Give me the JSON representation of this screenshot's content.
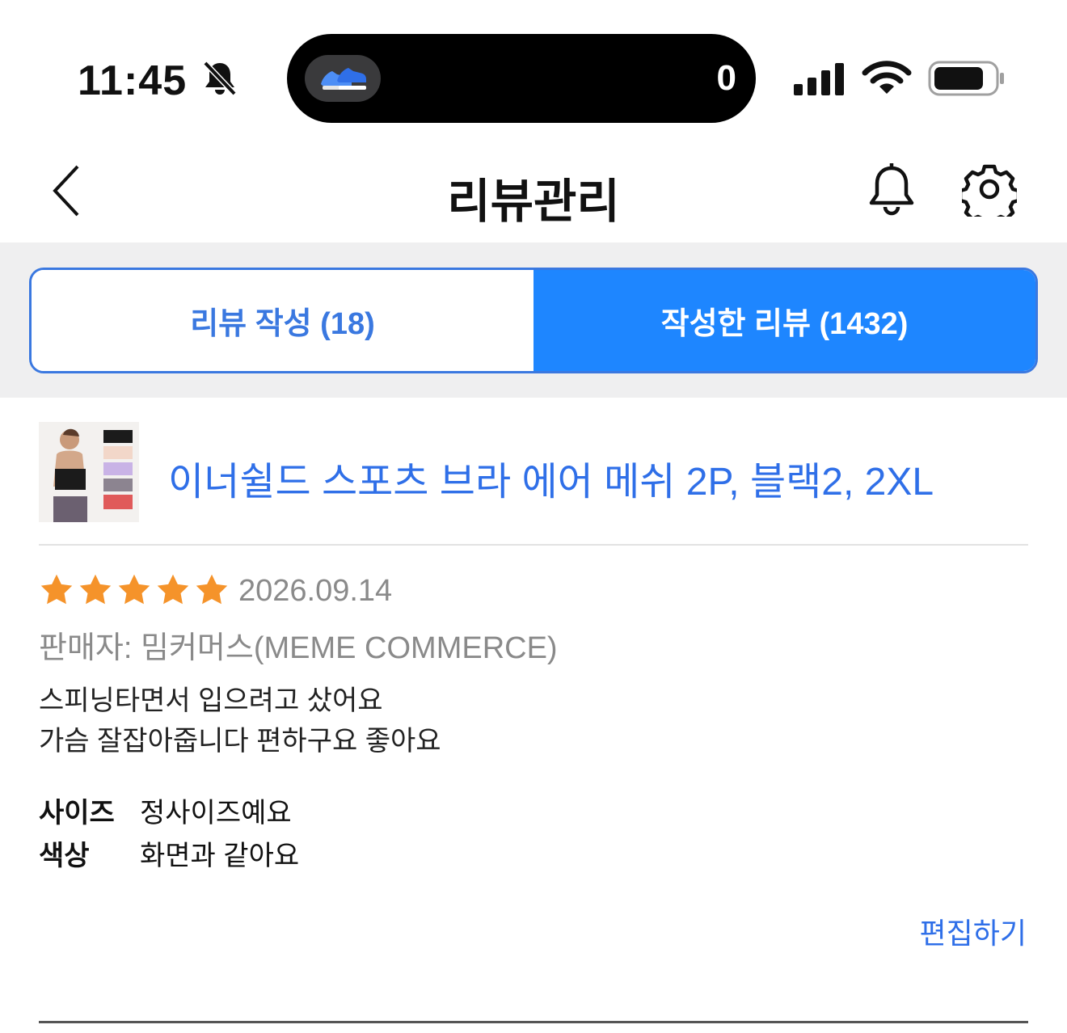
{
  "status_bar": {
    "time": "11:45",
    "island_count": "0",
    "icons": [
      "bell-slash-icon",
      "sneaker-app-icon",
      "signal-icon",
      "wifi-icon",
      "battery-icon"
    ]
  },
  "nav": {
    "title": "리뷰관리",
    "icons": [
      "back-chevron-icon",
      "bell-icon",
      "gear-icon"
    ]
  },
  "tabs": [
    {
      "label": "리뷰 작성 (18)",
      "active": false
    },
    {
      "label": "작성한 리뷰 (1432)",
      "active": true
    }
  ],
  "product": {
    "name": "이너쉴드 스포츠 브라 에어 메쉬 2P, 블랙2, 2XL"
  },
  "review": {
    "rating": 5,
    "max_rating": 5,
    "date": "2026.09.14",
    "seller_label": "판매자: ",
    "seller_name": "밈커머스(MEME COMMERCE)",
    "text_line1": "스피닝타면서 입으려고 샀어요",
    "text_line2": "가슴 잘잡아줍니다 편하구요 좋아요",
    "attributes": [
      {
        "key": "사이즈",
        "value": "정사이즈예요"
      },
      {
        "key": "색상",
        "value": "화면과 같아요"
      }
    ],
    "edit_label": "편집하기"
  },
  "colors": {
    "accent": "#1e86ff",
    "link": "#2f6fe8",
    "star": "#f5932a",
    "muted": "#8a8a8a"
  }
}
